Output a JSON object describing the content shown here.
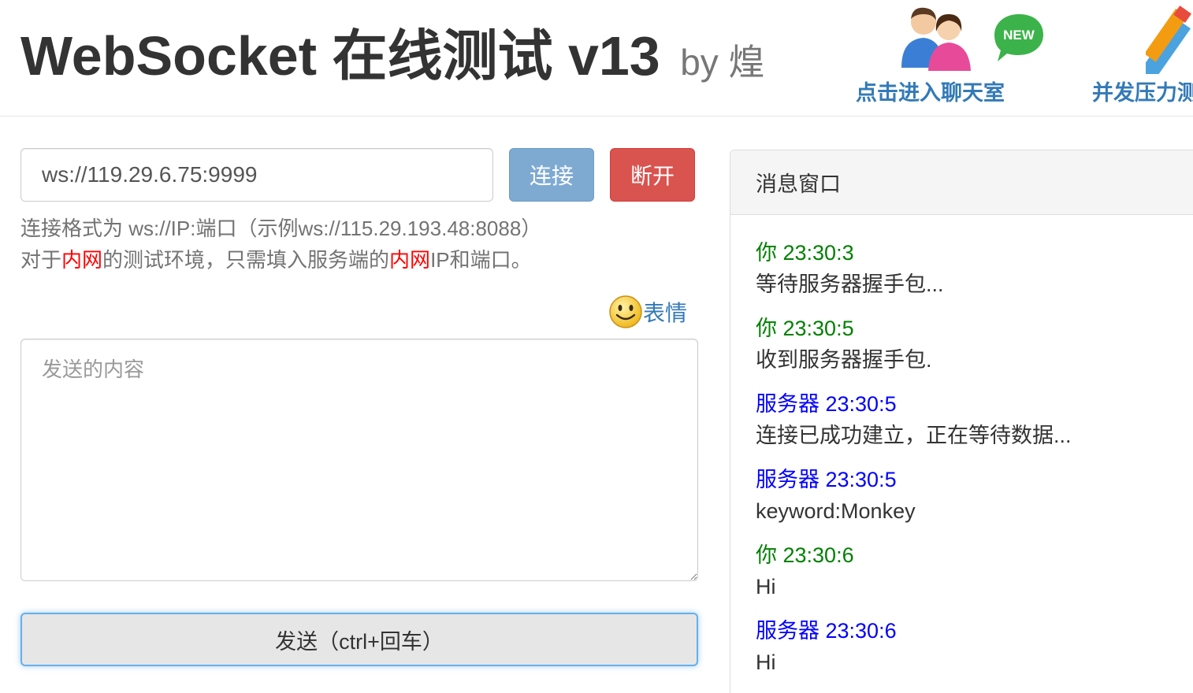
{
  "header": {
    "title_main": "WebSocket 在线测试 v13",
    "title_by": "by 煌",
    "chat_link": "点击进入聊天室",
    "stress_link": "并发压力测",
    "new_badge": "NEW"
  },
  "connection": {
    "url_value": "ws://119.29.6.75:9999",
    "connect_label": "连接",
    "disconnect_label": "断开",
    "help_line1": "连接格式为 ws://IP:端口（示例ws://115.29.193.48:8088）",
    "help_line2_a": "对于",
    "help_line2_red1": "内网",
    "help_line2_b": "的测试环境，只需填入服务端的",
    "help_line2_red2": "内网",
    "help_line2_c": "IP和端口。"
  },
  "composer": {
    "emoji_label": "表情",
    "placeholder": "发送的内容",
    "send_label": "发送（ctrl+回车）"
  },
  "messages": {
    "title": "消息窗口",
    "entries": [
      {
        "from": "you",
        "head": "你 23:30:3",
        "text": "等待服务器握手包..."
      },
      {
        "from": "you",
        "head": "你 23:30:5",
        "text": "收到服务器握手包."
      },
      {
        "from": "server",
        "head": "服务器 23:30:5",
        "text": "连接已成功建立，正在等待数据..."
      },
      {
        "from": "server",
        "head": "服务器 23:30:5",
        "text": "keyword:Monkey"
      },
      {
        "from": "you",
        "head": "你 23:30:6",
        "text": "Hi"
      },
      {
        "from": "server",
        "head": "服务器 23:30:6",
        "text": "Hi"
      }
    ]
  },
  "colors": {
    "you": "#008000",
    "server": "#0000ff",
    "link": "#337ab7",
    "danger": "#d9534f",
    "primary_disabled": "#7eaad2"
  }
}
